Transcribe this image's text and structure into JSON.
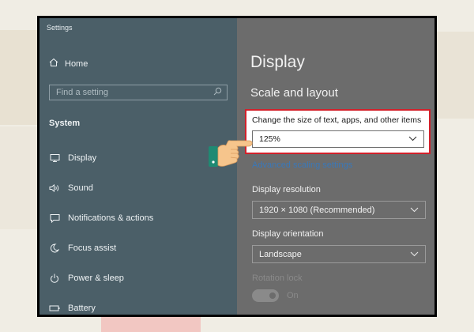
{
  "window": {
    "title": "Settings"
  },
  "nav": {
    "home_label": "Home",
    "search_placeholder": "Find a setting",
    "section_label": "System",
    "items": [
      {
        "label": "Display",
        "icon": "monitor-icon"
      },
      {
        "label": "Sound",
        "icon": "speaker-icon"
      },
      {
        "label": "Notifications & actions",
        "icon": "notification-icon"
      },
      {
        "label": "Focus assist",
        "icon": "moon-icon"
      },
      {
        "label": "Power & sleep",
        "icon": "power-icon"
      },
      {
        "label": "Battery",
        "icon": "battery-icon"
      }
    ]
  },
  "main": {
    "title": "Display",
    "section": "Scale and layout",
    "scale_label": "Change the size of text, apps, and other items",
    "scale_value": "125%",
    "advanced_link": "Advanced scaling settings",
    "resolution_label": "Display resolution",
    "resolution_value": "1920 × 1080 (Recommended)",
    "orientation_label": "Display orientation",
    "orientation_value": "Landscape",
    "rotation_lock_label": "Rotation lock",
    "rotation_lock_state": "On"
  },
  "colors": {
    "nav_bg": "#4b5f68",
    "content_bg": "#6c6c6c",
    "highlight_border": "#d3202a",
    "link": "#3a78b8",
    "hand_cuff": "#1f8a73",
    "hand_skin": "#f6c58c"
  }
}
